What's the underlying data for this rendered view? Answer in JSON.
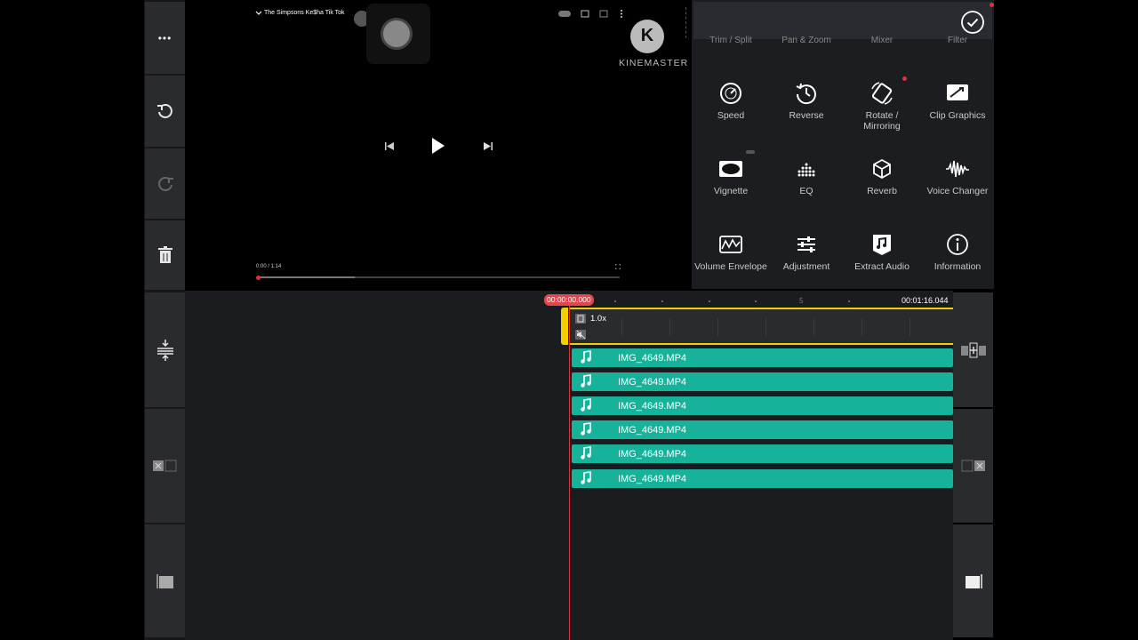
{
  "left_toolbar": {
    "more_label": "•••"
  },
  "preview": {
    "video_title": "The Simpsons Ke$ha Tik Tok",
    "time_display": "0:00 / 1:14",
    "watermark": "KINEMASTER",
    "watermark_letter": "K"
  },
  "panel": {
    "partial_labels": [
      "Trim / Split",
      "Pan & Zoom",
      "Mixer",
      "Filter"
    ],
    "tools": [
      {
        "label": "Speed",
        "icon": "speedometer-icon"
      },
      {
        "label": "Reverse",
        "icon": "reverse-icon"
      },
      {
        "label": "Rotate / Mirroring",
        "icon": "rotate-icon"
      },
      {
        "label": "Clip Graphics",
        "icon": "clip-graphics-icon"
      },
      {
        "label": "Vignette",
        "icon": "vignette-icon"
      },
      {
        "label": "EQ",
        "icon": "eq-icon"
      },
      {
        "label": "Reverb",
        "icon": "reverb-cube-icon"
      },
      {
        "label": "Voice Changer",
        "icon": "voice-changer-icon"
      },
      {
        "label": "Volume Envelope",
        "icon": "volume-envelope-icon"
      },
      {
        "label": "Adjustment",
        "icon": "adjustment-sliders-icon"
      },
      {
        "label": "Extract Audio",
        "icon": "extract-audio-icon"
      },
      {
        "label": "Information",
        "icon": "info-icon"
      }
    ]
  },
  "timeline": {
    "playhead_time": "00:00:00.000",
    "end_time": "00:01:16.044",
    "ruler_mark": "5",
    "speed_label": "1.0x",
    "audio_clips": [
      "IMG_4649.MP4",
      "IMG_4649.MP4",
      "IMG_4649.MP4",
      "IMG_4649.MP4",
      "IMG_4649.MP4",
      "IMG_4649.MP4"
    ]
  },
  "colors": {
    "accent_teal": "#16b39a",
    "accent_yellow": "#f2d000",
    "playhead_red": "#e0303a"
  }
}
